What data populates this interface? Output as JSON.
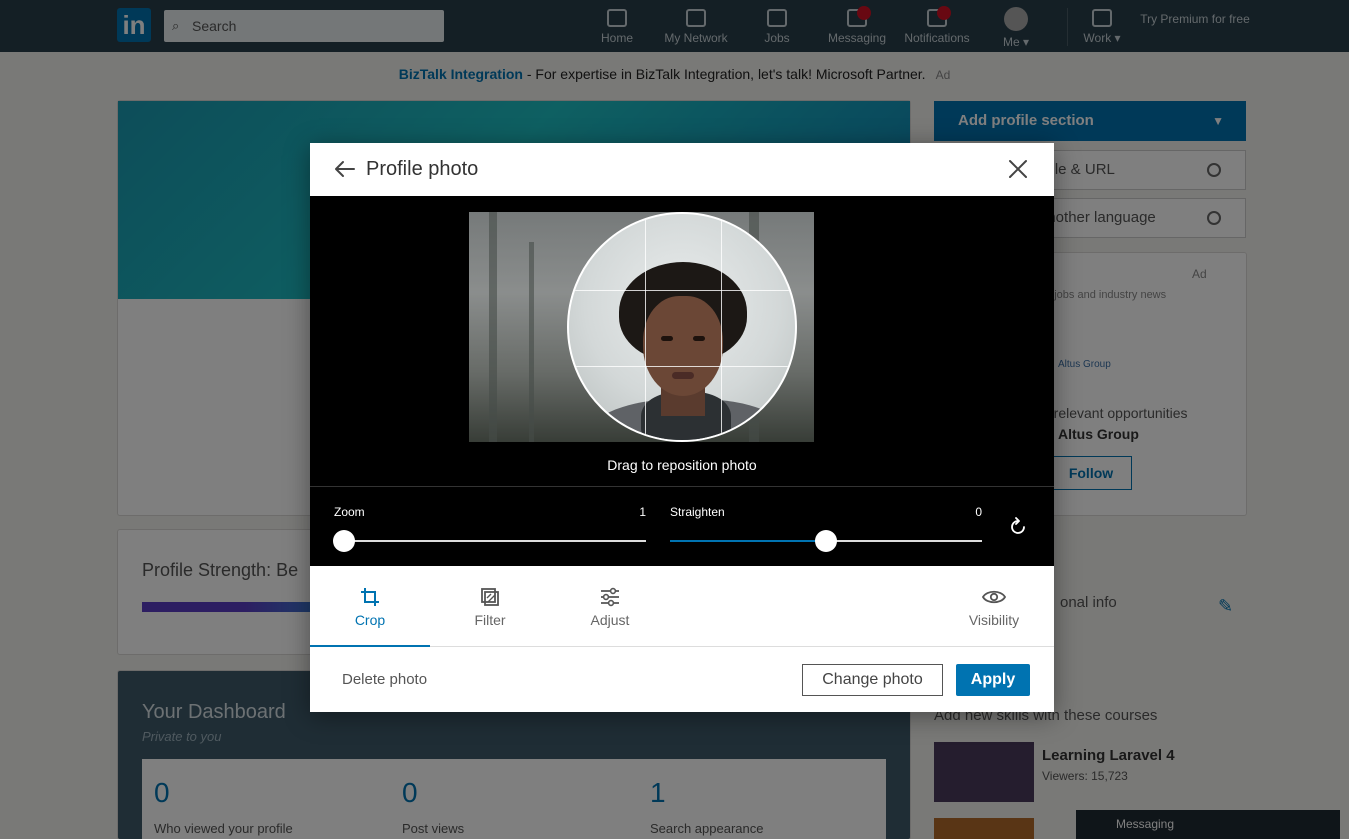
{
  "background": {
    "search_placeholder": "Search",
    "nav": [
      {
        "label": "Home",
        "icon": "home-icon"
      },
      {
        "label": "My Network",
        "icon": "network-icon"
      },
      {
        "label": "Jobs",
        "icon": "briefcase-icon"
      },
      {
        "label": "Messaging",
        "icon": "messaging-icon"
      },
      {
        "label": "Notifications",
        "icon": "bell-icon"
      },
      {
        "label": "Me ▾",
        "icon": "avatar-icon"
      },
      {
        "label": "Work ▾",
        "icon": "grid-icon"
      }
    ],
    "premium": "Try Premium for free",
    "ad_link": "BizTalk Integration",
    "ad_text": " - For expertise in BizTalk Integration, let's talk! Microsoft Partner.",
    "ad_label": "Ad",
    "profile_strength": "Profile Strength: Be",
    "dashboard_title": "Your Dashboard",
    "dashboard_sub": "Private to you",
    "dash_stats": [
      {
        "num": "0",
        "label": "Who viewed your profile"
      },
      {
        "num": "0",
        "label": "Post views"
      },
      {
        "num": "1",
        "label": "Search appearance"
      }
    ],
    "add_section": "Add profile section",
    "side_btn_1": "ofile & URL",
    "side_btn_2": "another language",
    "side_ad": "Ad",
    "side_jobs": "nt jobs and industry news",
    "company": "Altus Group",
    "side_opps": "e relevant opportunities",
    "side_company_line": "Altus Group",
    "follow": "Follow",
    "side_info": "onal info",
    "courses_heading": "Add new skills with these courses",
    "course_title": "Learning Laravel 4",
    "course_viewers": "Viewers: 15,723",
    "messaging": "Messaging"
  },
  "modal": {
    "title": "Profile photo",
    "drag_hint": "Drag to reposition photo",
    "zoom_label": "Zoom",
    "zoom_value": "1",
    "zoom_fraction": 0,
    "straighten_label": "Straighten",
    "straighten_value": "0",
    "straighten_fraction": 0.5,
    "tabs": [
      {
        "label": "Crop",
        "icon": "crop-icon",
        "active": true
      },
      {
        "label": "Filter",
        "icon": "filter-icon",
        "active": false
      },
      {
        "label": "Adjust",
        "icon": "sliders-icon",
        "active": false
      },
      {
        "label": "Visibility",
        "icon": "eye-icon",
        "active": false
      }
    ],
    "delete_label": "Delete photo",
    "change_label": "Change photo",
    "apply_label": "Apply",
    "accent_color": "#0073b1"
  }
}
